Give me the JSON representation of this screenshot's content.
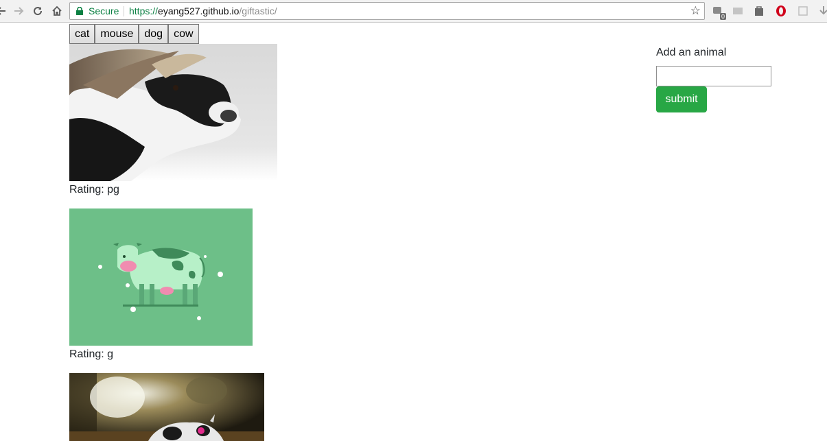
{
  "browser": {
    "secure_label": "Secure",
    "url_protocol": "https://",
    "url_host": "eyang527.github.io",
    "url_path": "/giftastic/",
    "extension_badge": "0",
    "icons": [
      "back-icon",
      "forward-icon",
      "reload-icon",
      "home-icon",
      "lock-icon",
      "bookmark-star-icon",
      "extension-icon",
      "opera-icon",
      "download-icon"
    ]
  },
  "topics": {
    "buttons": [
      "cat",
      "mouse",
      "dog",
      "cow"
    ]
  },
  "gifs": [
    {
      "rating_label": "Rating: pg",
      "subject": "cow"
    },
    {
      "rating_label": "Rating: g",
      "subject": "cow"
    },
    {
      "rating_label": "",
      "subject": "cow"
    }
  ],
  "form": {
    "label": "Add an animal",
    "input_value": "",
    "submit_label": "submit"
  },
  "colors": {
    "submit_bg": "#28a745",
    "gif2_bg": "#6dbf88",
    "secure_green": "#0b8043"
  }
}
